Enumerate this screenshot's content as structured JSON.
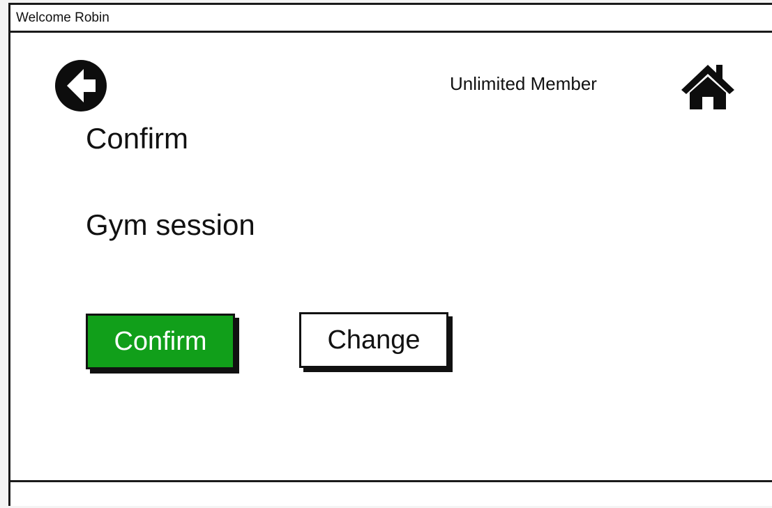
{
  "window": {
    "title": "Welcome Robin"
  },
  "header": {
    "back_icon": "back-arrow-icon",
    "membership": "Unlimited Member",
    "home_icon": "home-icon"
  },
  "main": {
    "title": "Confirm",
    "session": "Gym session",
    "confirm_label": "Confirm",
    "change_label": "Change"
  },
  "colors": {
    "confirm_button": "#119f1a",
    "confirm_text": "#ffffff",
    "border": "#1a1a1a"
  }
}
